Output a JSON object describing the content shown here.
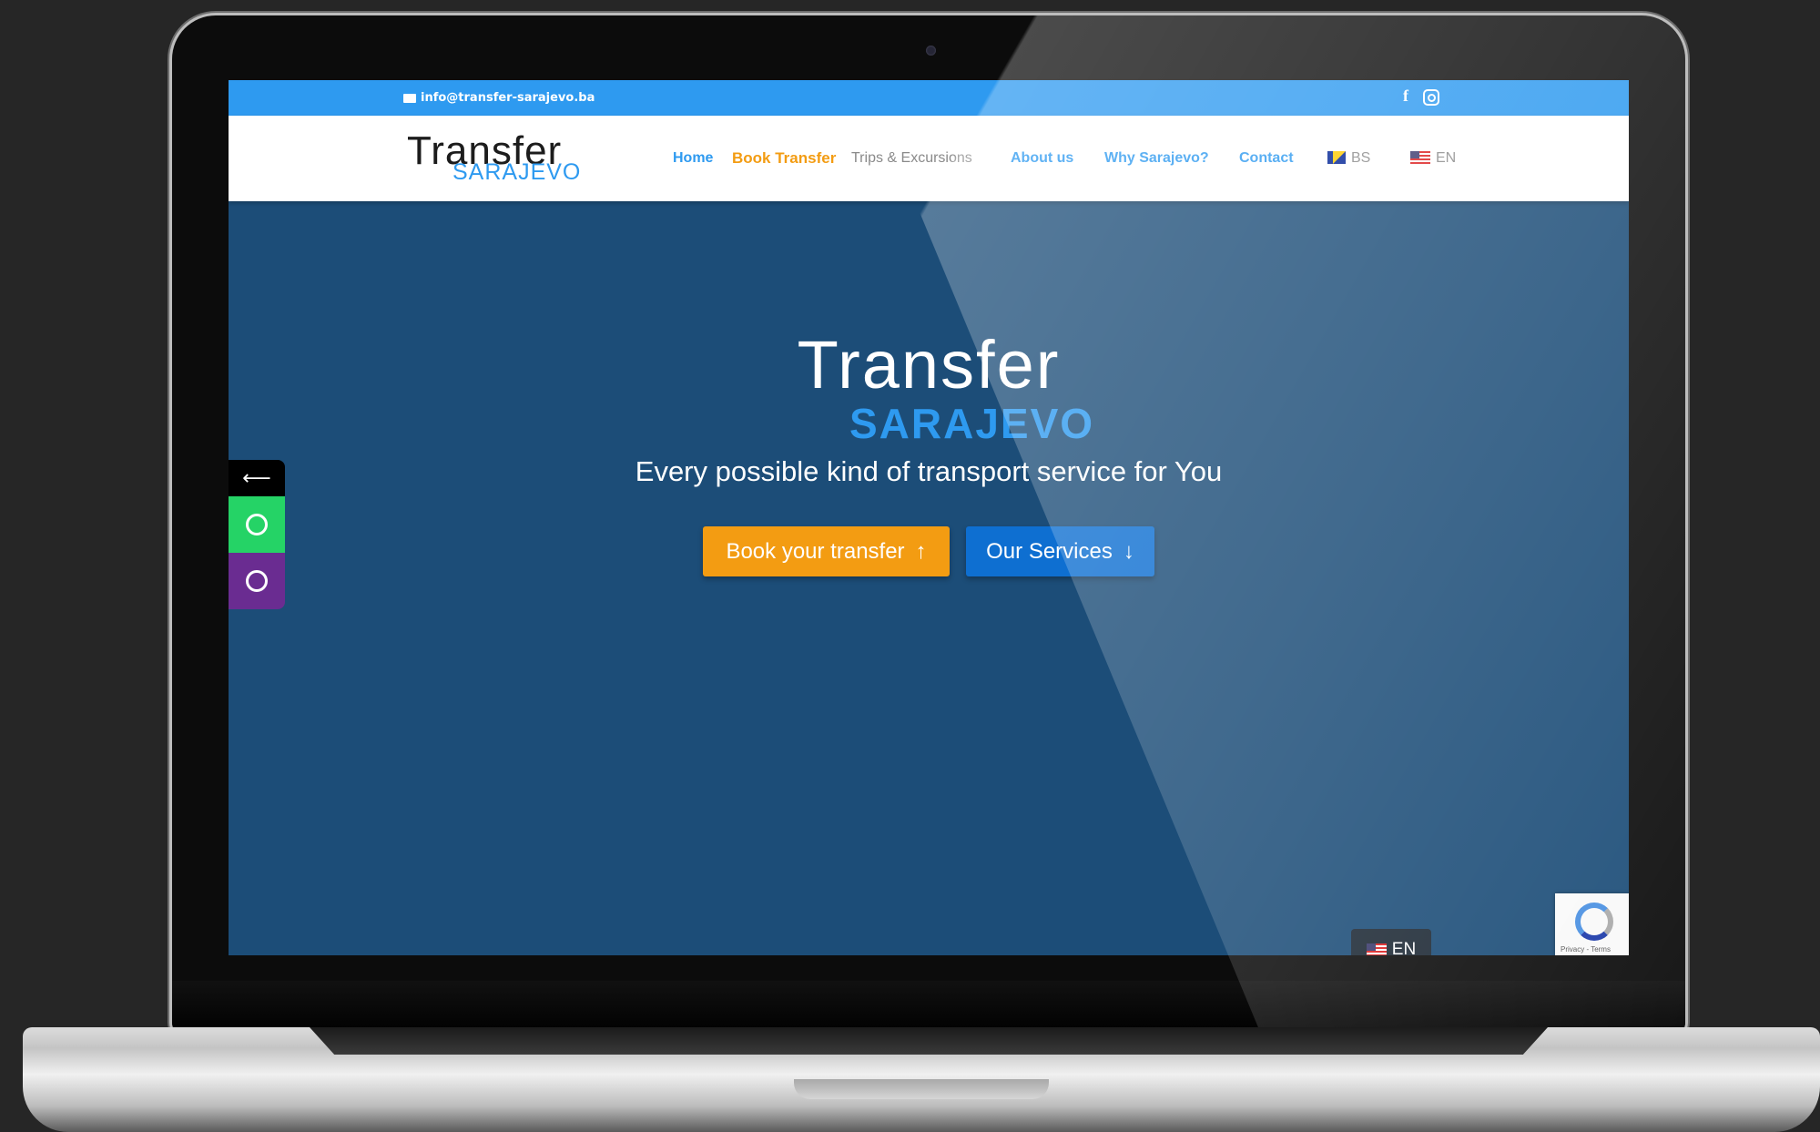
{
  "topbar": {
    "email": "info@transfer-sarajevo.ba",
    "facebook_icon": "facebook-icon",
    "instagram_icon": "instagram-icon"
  },
  "logo": {
    "line1": "Transfer",
    "line2": "SARAJEVO"
  },
  "nav": {
    "home": "Home",
    "book": "Book Transfer",
    "trips": "Trips & Excursions",
    "about": "About us",
    "why": "Why Sarajevo?",
    "contact": "Contact",
    "lang_bs": "BS",
    "lang_en": "EN"
  },
  "hero": {
    "title1": "Transfer",
    "title2": "SARAJEVO",
    "subtitle": "Every possible kind of transport service for You",
    "book_btn": "Book your transfer",
    "book_arrow": "↑",
    "services_btn": "Our Services",
    "services_arrow": "↓"
  },
  "side": {
    "close_glyph": "⟵",
    "whatsapp_icon": "whatsapp-icon",
    "viber_icon": "viber-icon"
  },
  "language_badge": "EN",
  "recaptcha": {
    "text": "Privacy - Terms"
  },
  "colors": {
    "brand_blue": "#2e9af0",
    "orange": "#f39c12",
    "hero_bg": "#1c4d78"
  }
}
